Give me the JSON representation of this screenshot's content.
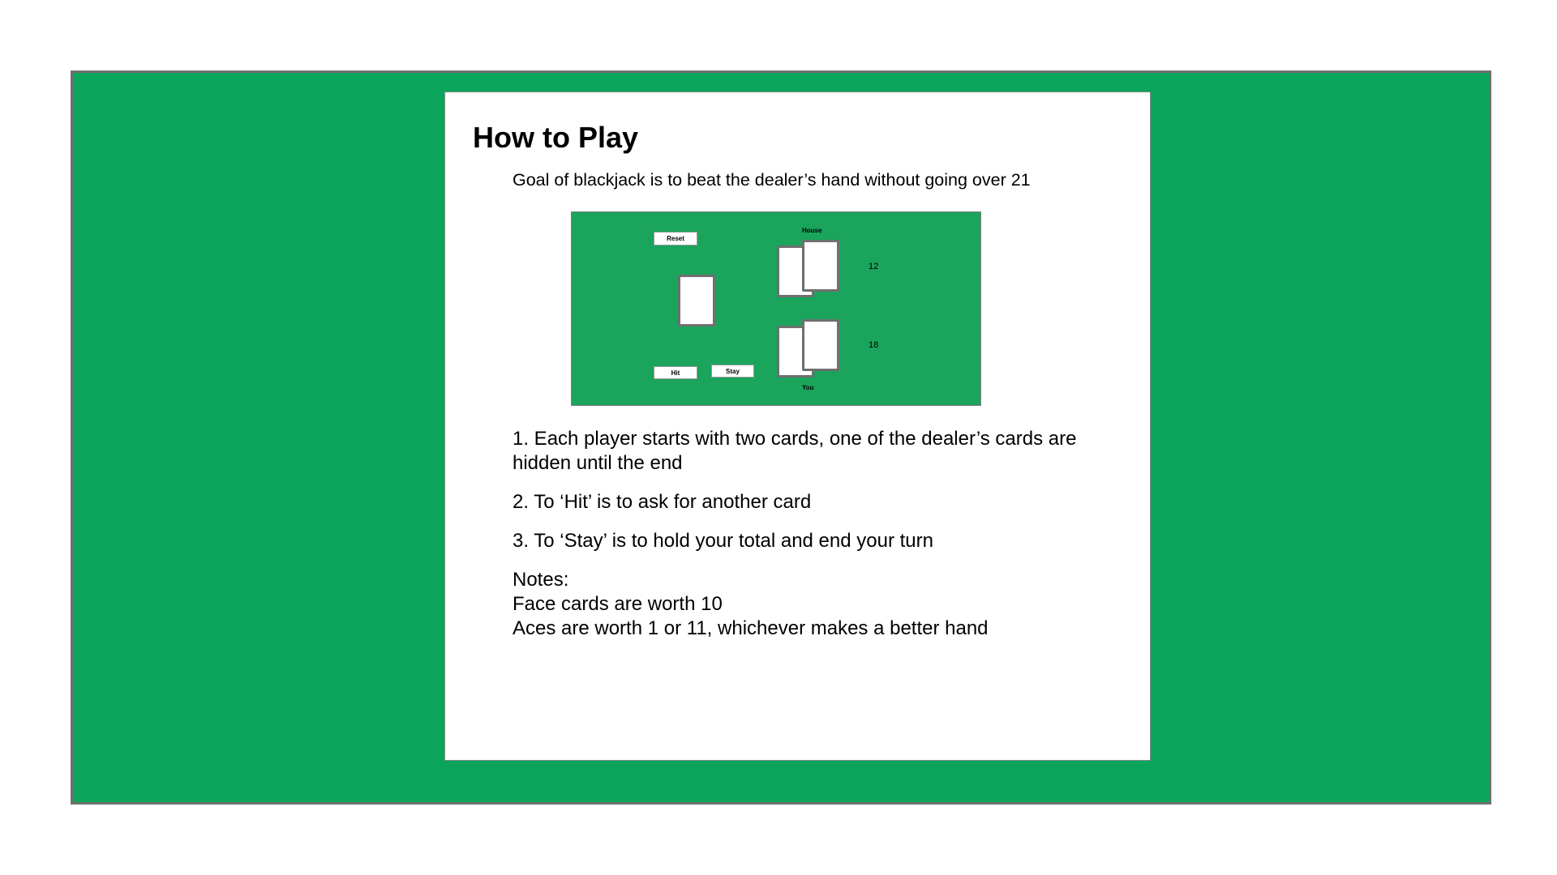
{
  "modal": {
    "title": "How to Play",
    "goal": "Goal of blackjack is to beat the dealer’s hand without going over 21"
  },
  "preview": {
    "reset_label": "Reset",
    "hit_label": "Hit",
    "stay_label": "Stay",
    "house_label": "House",
    "you_label": "You",
    "house_score": "12",
    "player_score": "18",
    "colors": {
      "table": "#1aa45c",
      "card_border": "#6f6f6f"
    }
  },
  "rules": [
    "1. Each player starts with two cards, one of the dealer’s cards are hidden until the end",
    "2. To ‘Hit’ is to ask for another card",
    "3. To ‘Stay’ is to hold your total and end your turn"
  ],
  "notes": {
    "heading": "Notes:",
    "lines": [
      "Face cards are worth 10",
      "Aces are worth 1 or 11, whichever makes a better hand"
    ]
  },
  "colors": {
    "background_table": "#0aa55b",
    "table_border": "#707070",
    "modal_bg": "#ffffff"
  }
}
